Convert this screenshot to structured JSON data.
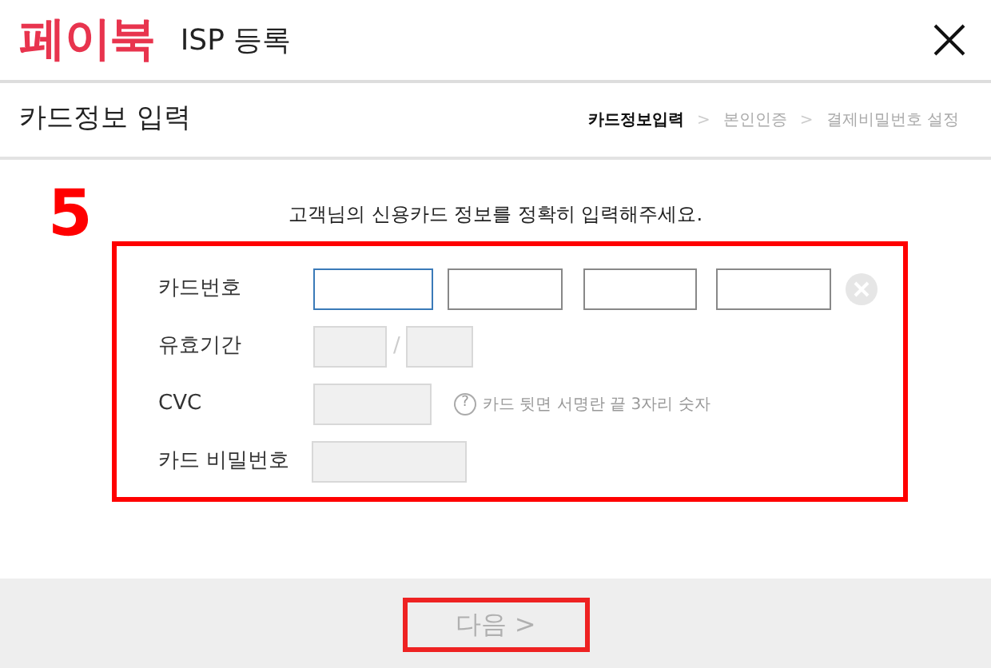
{
  "header": {
    "logo": "페이북",
    "title": "ISP 등록"
  },
  "subheader": {
    "title": "카드정보 입력",
    "steps": [
      {
        "label": "카드정보입력",
        "selected": true
      },
      {
        "label": "본인인증",
        "selected": false
      },
      {
        "label": "결제비밀번호 설정",
        "selected": false
      }
    ],
    "separator": ">"
  },
  "intro": "고객님의 신용카드 정보를 정확히 입력해주세요.",
  "annotation": {
    "label": "5"
  },
  "form": {
    "highlighted": true,
    "card_number": {
      "label": "카드번호",
      "fields": [
        {
          "focused": true
        },
        {
          "focused": false
        },
        {
          "focused": false
        },
        {
          "focused": false
        }
      ]
    },
    "expiry": {
      "label": "유효기간",
      "disabled": true,
      "separator": "/"
    },
    "cvc": {
      "label": "CVC",
      "disabled": true,
      "help_icon": "?",
      "hint": "카드 뒷면 서명란 끝 3자리 숫자"
    },
    "password": {
      "label": "카드 비밀번호",
      "disabled": true
    }
  },
  "next_button": {
    "label": "다음 >",
    "disabled": true,
    "highlighted": true
  }
}
